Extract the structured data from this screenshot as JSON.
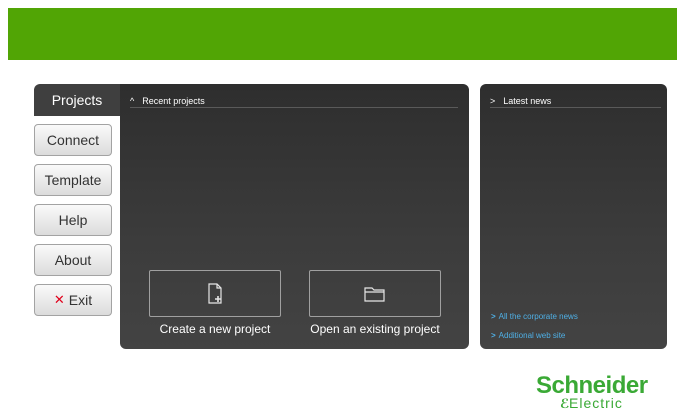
{
  "nav": {
    "active_tab": "Projects",
    "buttons": [
      "Connect",
      "Template",
      "Help",
      "About",
      "Exit"
    ]
  },
  "recent": {
    "header": "Recent projects",
    "create_label": "Create a new project",
    "open_label": "Open an existing project"
  },
  "news": {
    "header": "Latest news",
    "links": [
      "All the corporate news",
      "Additional web site"
    ]
  },
  "brand": {
    "name": "Schneider",
    "sub": "Electric",
    "color": "#3aa935"
  },
  "colors": {
    "topbar": "#51a505",
    "panel": "#3f3f3f",
    "link": "#4fb0e6",
    "exit": "#e0001b"
  }
}
